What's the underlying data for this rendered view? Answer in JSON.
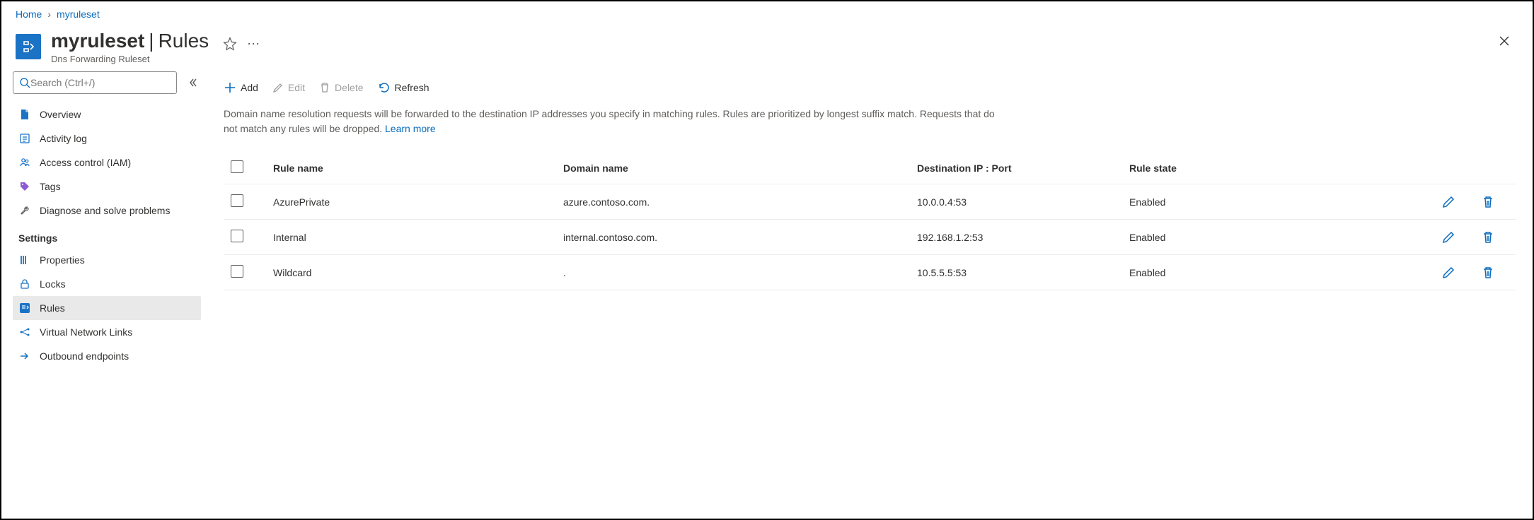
{
  "breadcrumb": {
    "home": "Home",
    "resource": "myruleset"
  },
  "header": {
    "title_resource": "myruleset",
    "title_section": "Rules",
    "subtitle": "Dns Forwarding Ruleset"
  },
  "search": {
    "placeholder": "Search (Ctrl+/)"
  },
  "sidebar": {
    "items": [
      {
        "label": "Overview"
      },
      {
        "label": "Activity log"
      },
      {
        "label": "Access control (IAM)"
      },
      {
        "label": "Tags"
      },
      {
        "label": "Diagnose and solve problems"
      }
    ],
    "section": "Settings",
    "settings": [
      {
        "label": "Properties"
      },
      {
        "label": "Locks"
      },
      {
        "label": "Rules",
        "selected": true
      },
      {
        "label": "Virtual Network Links"
      },
      {
        "label": "Outbound endpoints"
      }
    ]
  },
  "toolbar": {
    "add": "Add",
    "edit": "Edit",
    "delete": "Delete",
    "refresh": "Refresh"
  },
  "description": {
    "text": "Domain name resolution requests will be forwarded to the destination IP addresses you specify in matching rules. Rules are prioritized by longest suffix match. Requests that do not match any rules will be dropped. ",
    "link": "Learn more"
  },
  "table": {
    "headers": {
      "name": "Rule name",
      "domain": "Domain name",
      "dest": "Destination IP : Port",
      "state": "Rule state"
    },
    "rows": [
      {
        "name": "AzurePrivate",
        "domain": "azure.contoso.com.",
        "dest": "10.0.0.4:53",
        "state": "Enabled"
      },
      {
        "name": "Internal",
        "domain": "internal.contoso.com.",
        "dest": "192.168.1.2:53",
        "state": "Enabled"
      },
      {
        "name": "Wildcard",
        "domain": ".",
        "dest": "10.5.5.5:53",
        "state": "Enabled"
      }
    ]
  }
}
